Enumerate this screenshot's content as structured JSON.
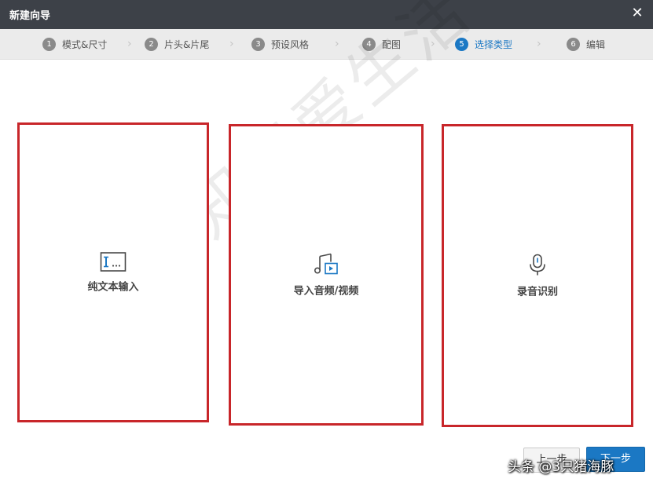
{
  "window": {
    "title": "新建向导",
    "close_glyph": "✕"
  },
  "steps": [
    {
      "num": "1",
      "label": "模式&尺寸",
      "active": false
    },
    {
      "num": "2",
      "label": "片头&片尾",
      "active": false
    },
    {
      "num": "3",
      "label": "预设风格",
      "active": false
    },
    {
      "num": "4",
      "label": "配图",
      "active": false
    },
    {
      "num": "5",
      "label": "选择类型",
      "active": true
    },
    {
      "num": "6",
      "label": "编辑",
      "active": false
    }
  ],
  "step_separator": "›",
  "cards": [
    {
      "label": "纯文本输入",
      "icon": "text-input-icon"
    },
    {
      "label": "导入音频/视频",
      "icon": "audio-video-import-icon"
    },
    {
      "label": "录音识别",
      "icon": "microphone-icon"
    }
  ],
  "footer": {
    "prev_label": "上一步",
    "next_label": "下一步"
  },
  "watermark": "学知识爱生活",
  "source_overlay": "头条 @3只猪海豚",
  "colors": {
    "accent": "#1b78c4",
    "highlight_border": "#c8262a",
    "titlebar": "#3d4148"
  }
}
